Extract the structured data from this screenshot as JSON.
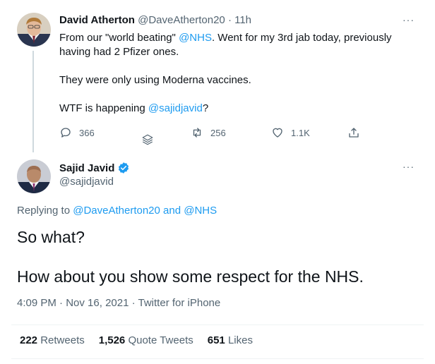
{
  "reply_to_tweet": {
    "author_name": "David Atherton",
    "author_handle": "@DaveAtherton20",
    "separator": "·",
    "time_ago": "11h",
    "text_line1_before": "From our \"world beating\" ",
    "text_line1_mention": "@NHS",
    "text_line1_after": ". Went for my 3rd jab today, previously",
    "text_line2": "having had 2 Pfizer ones.",
    "text_line3": "They were only using Moderna vaccines.",
    "text_line4_before": "WTF is happening ",
    "text_line4_mention": "@sajidjavid",
    "text_line4_after": "?",
    "reply_count": "366",
    "retweet_count": "256",
    "like_count": "1.1K",
    "more_label": "···"
  },
  "main_tweet": {
    "author_name": "Sajid Javid",
    "author_handle": "@sajidjavid",
    "more_label": "···",
    "replying_prefix": "Replying to ",
    "replying_user1": "@DaveAtherton20",
    "replying_and": " and ",
    "replying_user2": "@NHS",
    "text_line1": "So what?",
    "text_line2": "How about you show some respect for the NHS.",
    "time": "4:09 PM",
    "date": "Nov 16, 2021",
    "source": "Twitter for iPhone",
    "meta_separator": " · ",
    "retweets_count": "222",
    "retweets_label": "Retweets",
    "quote_count": "1,526",
    "quote_label": "Quote Tweets",
    "likes_count": "651",
    "likes_label": "Likes"
  },
  "colors": {
    "accent": "#1d9bf0",
    "secondary_text": "#536471",
    "primary_text": "#0f1419"
  },
  "icons": [
    "reply-icon",
    "retweet-icon",
    "like-icon",
    "share-icon",
    "stack-icon",
    "verified-icon",
    "more-icon"
  ]
}
